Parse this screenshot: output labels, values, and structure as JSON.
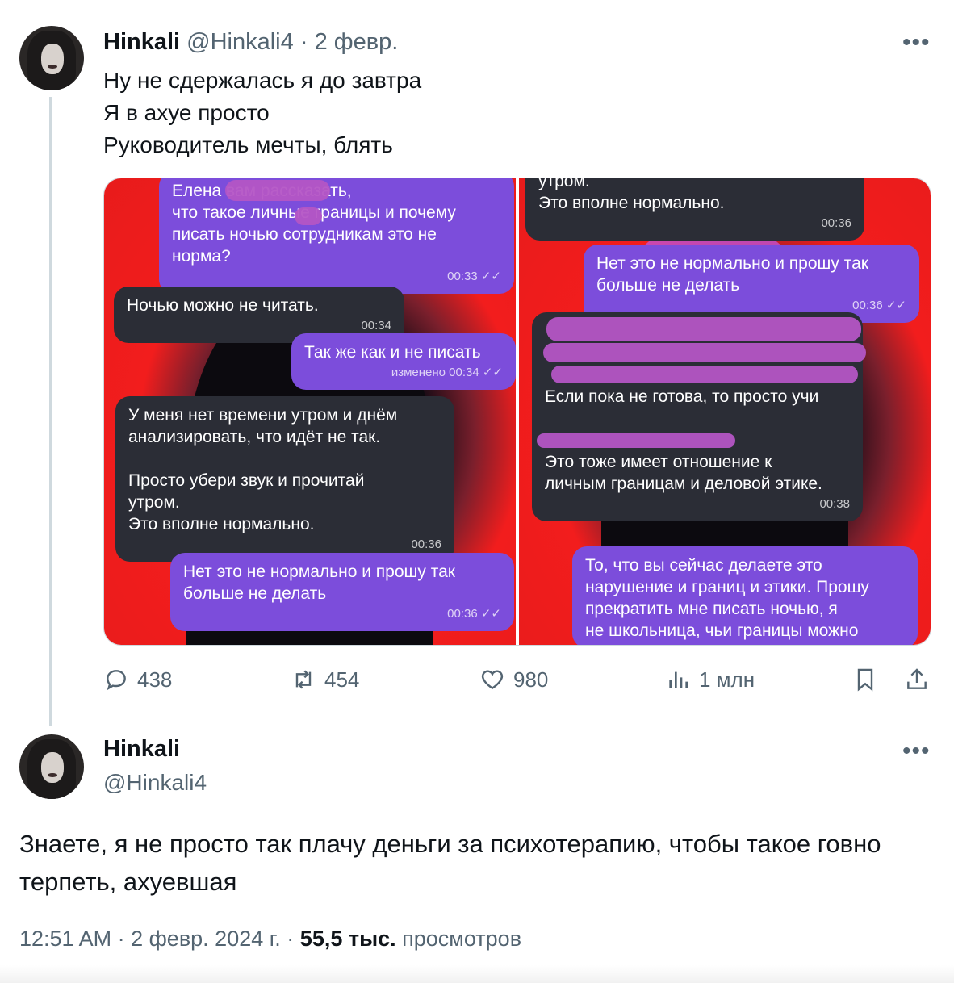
{
  "tweet1": {
    "name": "Hinkali",
    "handle": "@Hinkali4",
    "date": "2 февр.",
    "more": "•••",
    "lines": [
      "Ну не сдержалась я до завтра",
      "Я в ахуе просто",
      "Руководитель мечты, блять"
    ],
    "media": {
      "left": [
        {
          "dir": "out",
          "lines": [
            "Елена             вам рассказать,",
            "что такое личные границы и почему",
            "писать ночью сотрудникам это не",
            "норма?"
          ],
          "time": "00:33 ✓✓"
        },
        {
          "dir": "in",
          "lines": [
            "Ночью можно не читать."
          ],
          "time": "00:34"
        },
        {
          "dir": "out",
          "lines": [
            "Так же как и не писать"
          ],
          "time": "изменено 00:34 ✓✓"
        },
        {
          "dir": "in",
          "lines": [
            "У меня нет времени утром и днём",
            "анализировать, что идёт не так.",
            "",
            "Просто убери звук и прочитай",
            "утром.",
            "Это вполне нормально."
          ],
          "time": "00:36"
        },
        {
          "dir": "out",
          "lines": [
            "Нет  это не нормально и прошу так",
            "больше не делать"
          ],
          "time": "00:36 ✓✓"
        }
      ],
      "right": [
        {
          "dir": "in",
          "lines": [
            "утром.",
            "Это вполне нормально."
          ],
          "time": "00:36"
        },
        {
          "dir": "out",
          "lines": [
            "Нет  это не нормально и прошу так",
            "больше не делать"
          ],
          "time": "00:36 ✓✓"
        },
        {
          "dir": "in",
          "lines": [
            "",
            "",
            "",
            "Если пока не готова, то просто учи",
            "",
            "",
            "Это тоже имеет отношение к",
            "личным границам и деловой этике."
          ],
          "time": "00:38"
        },
        {
          "dir": "out",
          "lines": [
            "То, что вы сейчас делаете это",
            "нарушение и границ и этики. Прошу",
            "прекратить мне писать ночью, я",
            "не школьница, чьи границы можно"
          ],
          "time": ""
        }
      ]
    },
    "actions": {
      "replies": "438",
      "reposts": "454",
      "likes": "980",
      "views": "1 млн"
    }
  },
  "tweet2": {
    "name": "Hinkali",
    "handle": "@Hinkali4",
    "more": "•••",
    "text": "Знаете, я не просто так плачу деньги за психотерапию, чтобы такое говно терпеть, ахуевшая",
    "time": "12:51 AM · 2 февр. 2024 г. · ",
    "views_count": "55,5 тыс.",
    "views_label": " просмотров"
  },
  "colors": {
    "accent": "#1d9bf0",
    "muted": "#536471",
    "bubble_out": "#7c4ddb",
    "bubble_in": "#2b2d36",
    "bg_red": "#e81b1b"
  }
}
